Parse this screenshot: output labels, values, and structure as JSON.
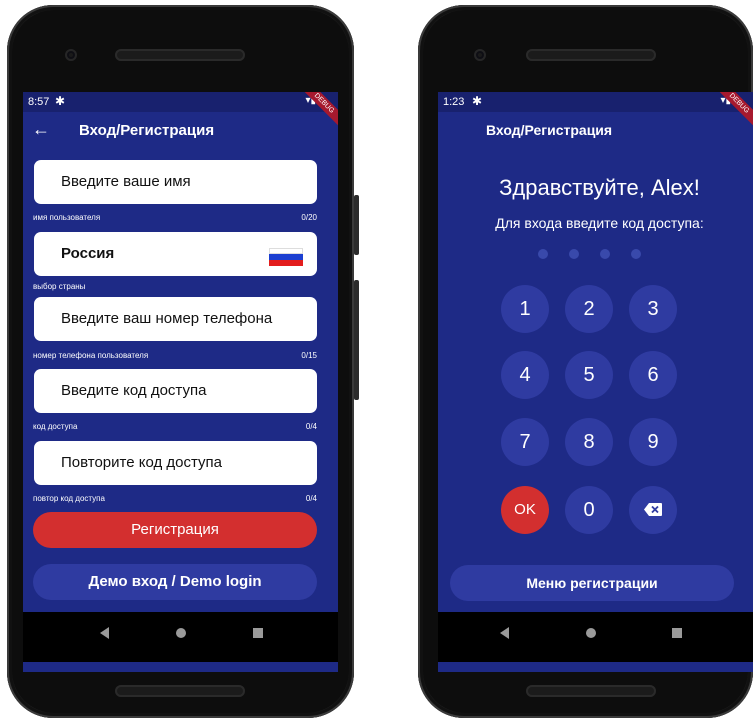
{
  "left_phone": {
    "status": {
      "time": "8:57",
      "gear_icon": "✱",
      "signal_icon": "▾▮",
      "debug_badge": "DEBUG"
    },
    "appbar": {
      "back_icon": "←",
      "title": "Вход/Регистрация"
    },
    "name_field": {
      "placeholder": "Введите ваше имя",
      "helper": "имя пользователя",
      "counter": "0/20"
    },
    "country_field": {
      "value": "Россия",
      "helper": "выбор страны",
      "flag_colors": [
        "#ffffff",
        "#1c3fd1",
        "#e31d1d"
      ]
    },
    "phone_field": {
      "placeholder": "Введите ваш номер телефона",
      "helper": "номер телефона пользователя",
      "counter": "0/15"
    },
    "code_field": {
      "placeholder": "Введите код доступа",
      "helper": "код доступа",
      "counter": "0/4"
    },
    "repeat_field": {
      "placeholder": "Повторите код доступа",
      "helper": "повтор код доступа",
      "counter": "0/4"
    },
    "register_button": "Регистрация",
    "demo_button": "Демо вход / Demo login"
  },
  "right_phone": {
    "status": {
      "time": "1:23",
      "gear_icon": "✱",
      "signal_icon": "▾▮",
      "debug_badge": "DEBUG"
    },
    "appbar": {
      "title": "Вход/Регистрация"
    },
    "greeting": "Здравствуйте, Alex!",
    "prompt": "Для входа введите код доступа:",
    "pin_dots": 4,
    "keys": [
      "1",
      "2",
      "3",
      "4",
      "5",
      "6",
      "7",
      "8",
      "9",
      "OK",
      "0",
      "backspace"
    ],
    "menu_button": "Меню регистрации"
  },
  "nav_icons": [
    "back-triangle",
    "home-circle",
    "recents-square"
  ],
  "colors": {
    "primary": "#1e2a86",
    "status_bar": "#18216e",
    "button_blue": "#2f3ba1",
    "button_red": "#d32f2f",
    "pin_dot": "#3949ab"
  }
}
